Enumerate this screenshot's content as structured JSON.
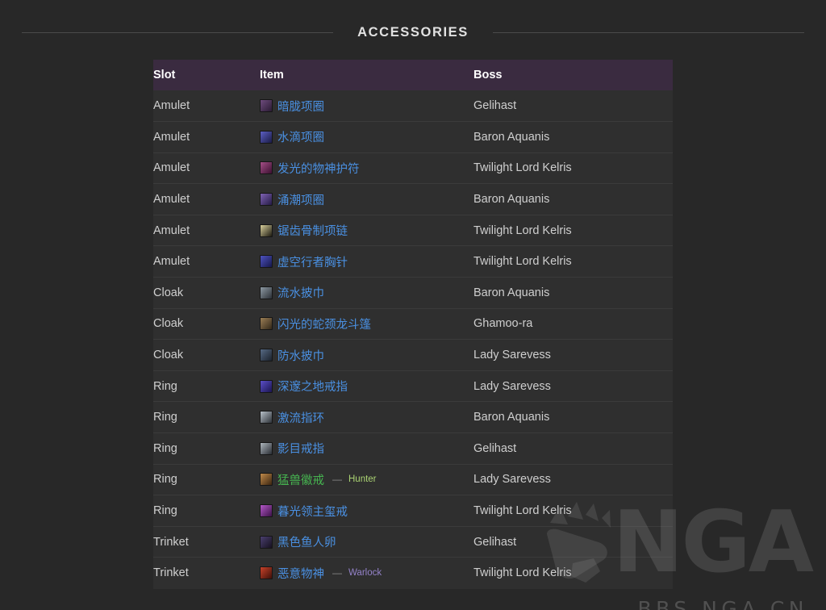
{
  "section": {
    "title": "ACCESSORIES"
  },
  "table": {
    "columns": {
      "slot": "Slot",
      "item": "Item",
      "boss": "Boss"
    },
    "rows": [
      {
        "slot": "Amulet",
        "item": "暗胧项圈",
        "quality": "rare",
        "icon": "#6e4b7d",
        "icon2": "#2a1b33",
        "class": "",
        "boss": "Gelihast"
      },
      {
        "slot": "Amulet",
        "item": "水滴项圈",
        "quality": "rare",
        "icon": "#5c5fc4",
        "icon2": "#1a1b44",
        "class": "",
        "boss": "Baron Aquanis"
      },
      {
        "slot": "Amulet",
        "item": "发光的物神护符",
        "quality": "rare",
        "icon": "#a44f86",
        "icon2": "#3b1030",
        "class": "",
        "boss": "Twilight Lord Kelris"
      },
      {
        "slot": "Amulet",
        "item": "涌潮项圈",
        "quality": "rare",
        "icon": "#7f63b4",
        "icon2": "#241a44",
        "class": "",
        "boss": "Baron Aquanis"
      },
      {
        "slot": "Amulet",
        "item": "锯齿骨制项链",
        "quality": "rare",
        "icon": "#d8cf9c",
        "icon2": "#1d1a10",
        "class": "",
        "boss": "Twilight Lord Kelris"
      },
      {
        "slot": "Amulet",
        "item": "虚空行者胸针",
        "quality": "rare",
        "icon": "#4e52c0",
        "icon2": "#16184a",
        "class": "",
        "boss": "Twilight Lord Kelris"
      },
      {
        "slot": "Cloak",
        "item": "流水披巾",
        "quality": "rare",
        "icon": "#8e9aa4",
        "icon2": "#2b3036",
        "class": "",
        "boss": "Baron Aquanis"
      },
      {
        "slot": "Cloak",
        "item": "闪光的蛇颈龙斗篷",
        "quality": "rare",
        "icon": "#9b7e55",
        "icon2": "#33281a",
        "class": "",
        "boss": "Ghamoo-ra"
      },
      {
        "slot": "Cloak",
        "item": "防水披巾",
        "quality": "rare",
        "icon": "#566a84",
        "icon2": "#1c222c",
        "class": "",
        "boss": "Lady Sarevess"
      },
      {
        "slot": "Ring",
        "item": "深邃之地戒指",
        "quality": "rare",
        "icon": "#5b4ec8",
        "icon2": "#1b1550",
        "class": "",
        "boss": "Lady Sarevess"
      },
      {
        "slot": "Ring",
        "item": "激流指环",
        "quality": "rare",
        "icon": "#b8c0c8",
        "icon2": "#2d3238",
        "class": "",
        "boss": "Baron Aquanis"
      },
      {
        "slot": "Ring",
        "item": "影目戒指",
        "quality": "rare",
        "icon": "#aeb6bd",
        "icon2": "#282c32",
        "class": "",
        "boss": "Gelihast"
      },
      {
        "slot": "Ring",
        "item": "猛兽徽戒",
        "quality": "uncommon",
        "icon": "#c08a4a",
        "icon2": "#3a2410",
        "class": "Hunter",
        "class_color": "#abd473",
        "boss": "Lady Sarevess"
      },
      {
        "slot": "Ring",
        "item": "暮光领主玺戒",
        "quality": "rare",
        "icon": "#b458c8",
        "icon2": "#3d1248",
        "class": "",
        "boss": "Twilight Lord Kelris"
      },
      {
        "slot": "Trinket",
        "item": "黑色鱼人卵",
        "quality": "rare",
        "icon": "#4a3f6e",
        "icon2": "#16111f",
        "class": "",
        "boss": "Gelihast"
      },
      {
        "slot": "Trinket",
        "item": "恶意物神",
        "quality": "rare",
        "icon": "#c8422a",
        "icon2": "#3e1008",
        "class": "Warlock",
        "class_color": "#9482c9",
        "boss": "Twilight Lord Kelris"
      }
    ],
    "class_separator": "—"
  },
  "watermark": {
    "brand": "NGA",
    "site": "BBS.NGA.CN"
  },
  "colors": {
    "page_background": "#282828",
    "table_header_background": "#3a2b40",
    "row_background": "#2f2f2f",
    "row_border": "#3b3b3b",
    "link_rare": "#4a90e2",
    "link_uncommon": "#46b450",
    "rule": "#4a4a4a"
  }
}
